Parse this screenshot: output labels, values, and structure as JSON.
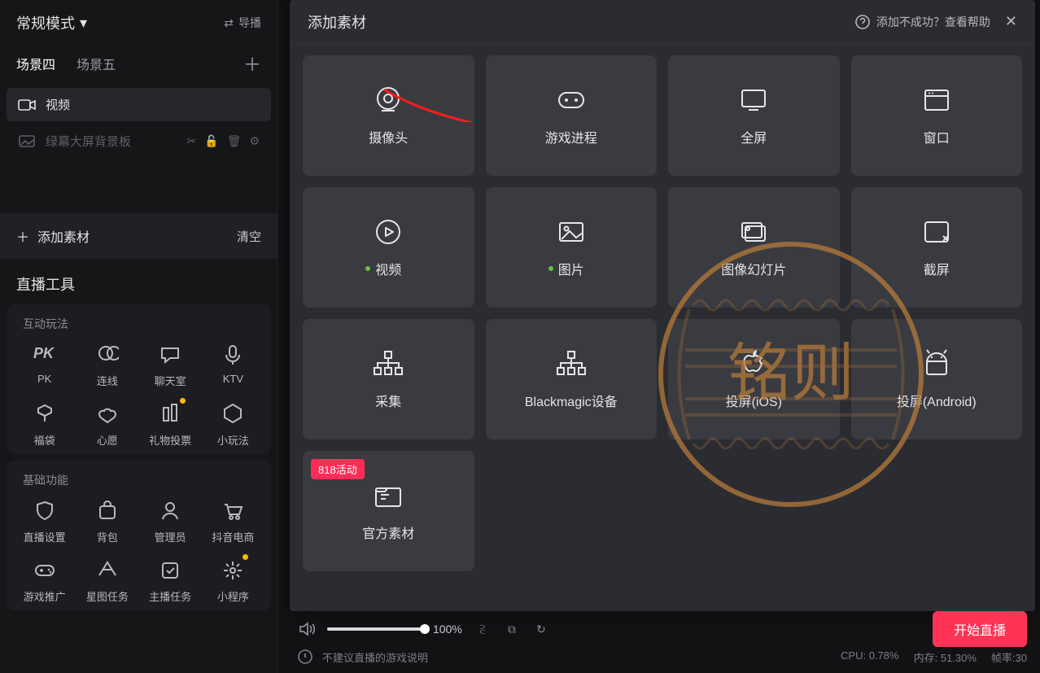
{
  "mode": {
    "label": "常规模式",
    "exportLabel": "导播"
  },
  "sceneTabs": {
    "items": [
      "场景四",
      "场景五"
    ],
    "activeIndex": 0
  },
  "sources": [
    {
      "label": "视频",
      "icon": "camera",
      "dim": false
    },
    {
      "label": "绿幕大屏背景板",
      "icon": "image",
      "dim": true
    }
  ],
  "addRow": {
    "addLabel": "添加素材",
    "clearLabel": "清空"
  },
  "toolsSection": {
    "title": "直播工具",
    "groups": [
      {
        "head": "互动玩法",
        "items": [
          {
            "label": "PK",
            "icon": "pk"
          },
          {
            "label": "连线",
            "icon": "link"
          },
          {
            "label": "聊天室",
            "icon": "chat"
          },
          {
            "label": "KTV",
            "icon": "mic"
          },
          {
            "label": "福袋",
            "icon": "bag"
          },
          {
            "label": "心愿",
            "icon": "wish"
          },
          {
            "label": "礼物投票",
            "icon": "vote",
            "dot": true
          },
          {
            "label": "小玩法",
            "icon": "hex"
          }
        ]
      },
      {
        "head": "基础功能",
        "items": [
          {
            "label": "直播设置",
            "icon": "shield"
          },
          {
            "label": "背包",
            "icon": "pack"
          },
          {
            "label": "管理员",
            "icon": "admin"
          },
          {
            "label": "抖音电商",
            "icon": "cart"
          },
          {
            "label": "游戏推广",
            "icon": "gamepad"
          },
          {
            "label": "星图任务",
            "icon": "star"
          },
          {
            "label": "主播任务",
            "icon": "task"
          },
          {
            "label": "小程序",
            "icon": "burst",
            "dot": true
          }
        ]
      }
    ]
  },
  "modal": {
    "title": "添加素材",
    "helpText": "添加不成功？查看帮助",
    "badge": "818活动",
    "tiles": [
      {
        "label": "摄像头",
        "icon": "camera"
      },
      {
        "label": "游戏进程",
        "icon": "gamepad"
      },
      {
        "label": "全屏",
        "icon": "monitor"
      },
      {
        "label": "窗口",
        "icon": "window"
      },
      {
        "label": "视频",
        "icon": "play",
        "greenDot": true
      },
      {
        "label": "图片",
        "icon": "image",
        "greenDot": true
      },
      {
        "label": "图像幻灯片",
        "icon": "slides"
      },
      {
        "label": "截屏",
        "icon": "crop"
      },
      {
        "label": "采集",
        "icon": "tree"
      },
      {
        "label": "Blackmagic设备",
        "icon": "tree"
      },
      {
        "label": "投屏(iOS)",
        "icon": "apple"
      },
      {
        "label": "投屏(Android)",
        "icon": "android"
      },
      {
        "label": "官方素材",
        "icon": "folder",
        "badge": true
      }
    ]
  },
  "controls": {
    "volumePct": 100,
    "volumeLabel": "100%"
  },
  "startButton": "开始直播",
  "bottom": {
    "warnText": "不建议直播的游戏说明",
    "cpuLabel": "CPU: 0.78%",
    "memLabel": "内存: 51.30%",
    "fpsLabel": "帧率:30"
  },
  "watermarkText": "铭则"
}
